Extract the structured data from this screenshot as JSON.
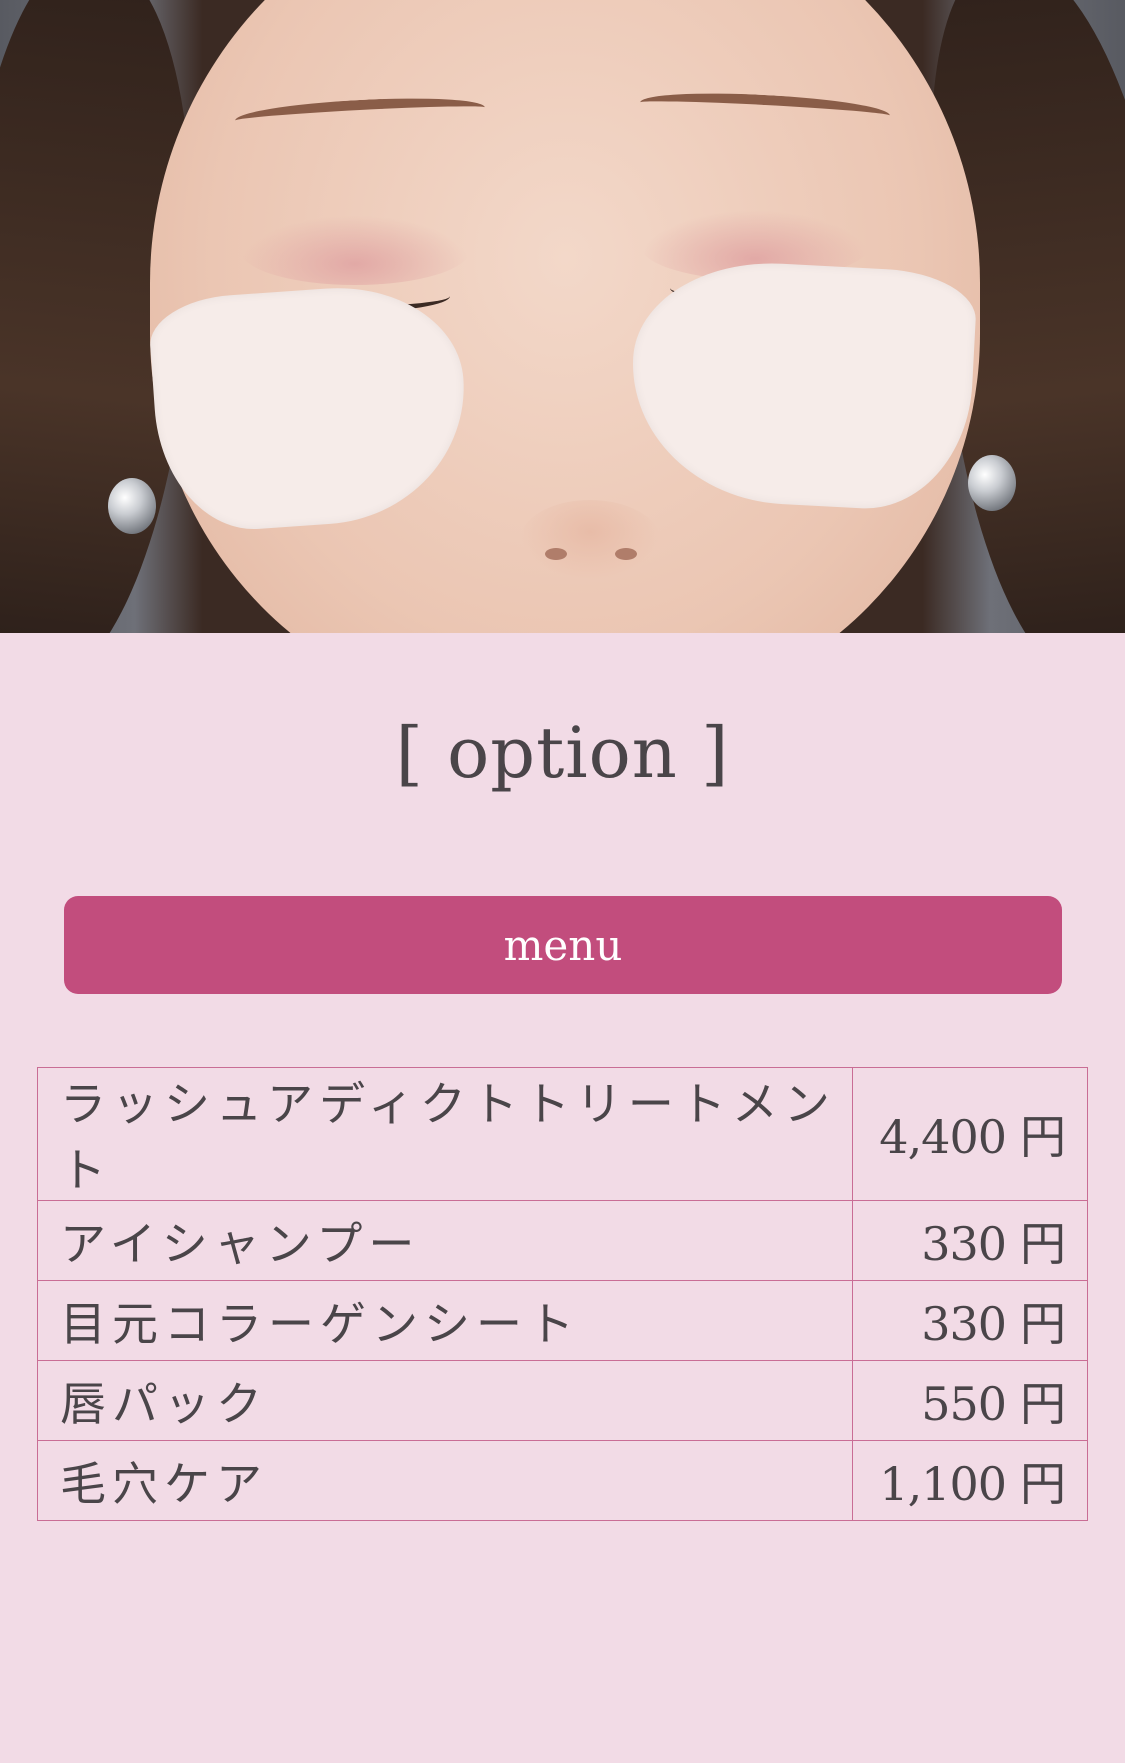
{
  "heading": "[ option ]",
  "menu_label": "menu",
  "items": [
    {
      "name": "ラッシュアディクトトリートメント",
      "price": "4,400",
      "unit": "円"
    },
    {
      "name": "アイシャンプー",
      "price": "330",
      "unit": "円"
    },
    {
      "name": "目元コラーゲンシート",
      "price": "330",
      "unit": "円"
    },
    {
      "name": "唇パック",
      "price": "550",
      "unit": "円"
    },
    {
      "name": "毛穴ケア",
      "price": "1,100",
      "unit": "円"
    }
  ],
  "colors": {
    "background": "#f2dbe6",
    "accent": "#c24d7d",
    "table_border": "#c96d95",
    "text": "#4a4549"
  }
}
